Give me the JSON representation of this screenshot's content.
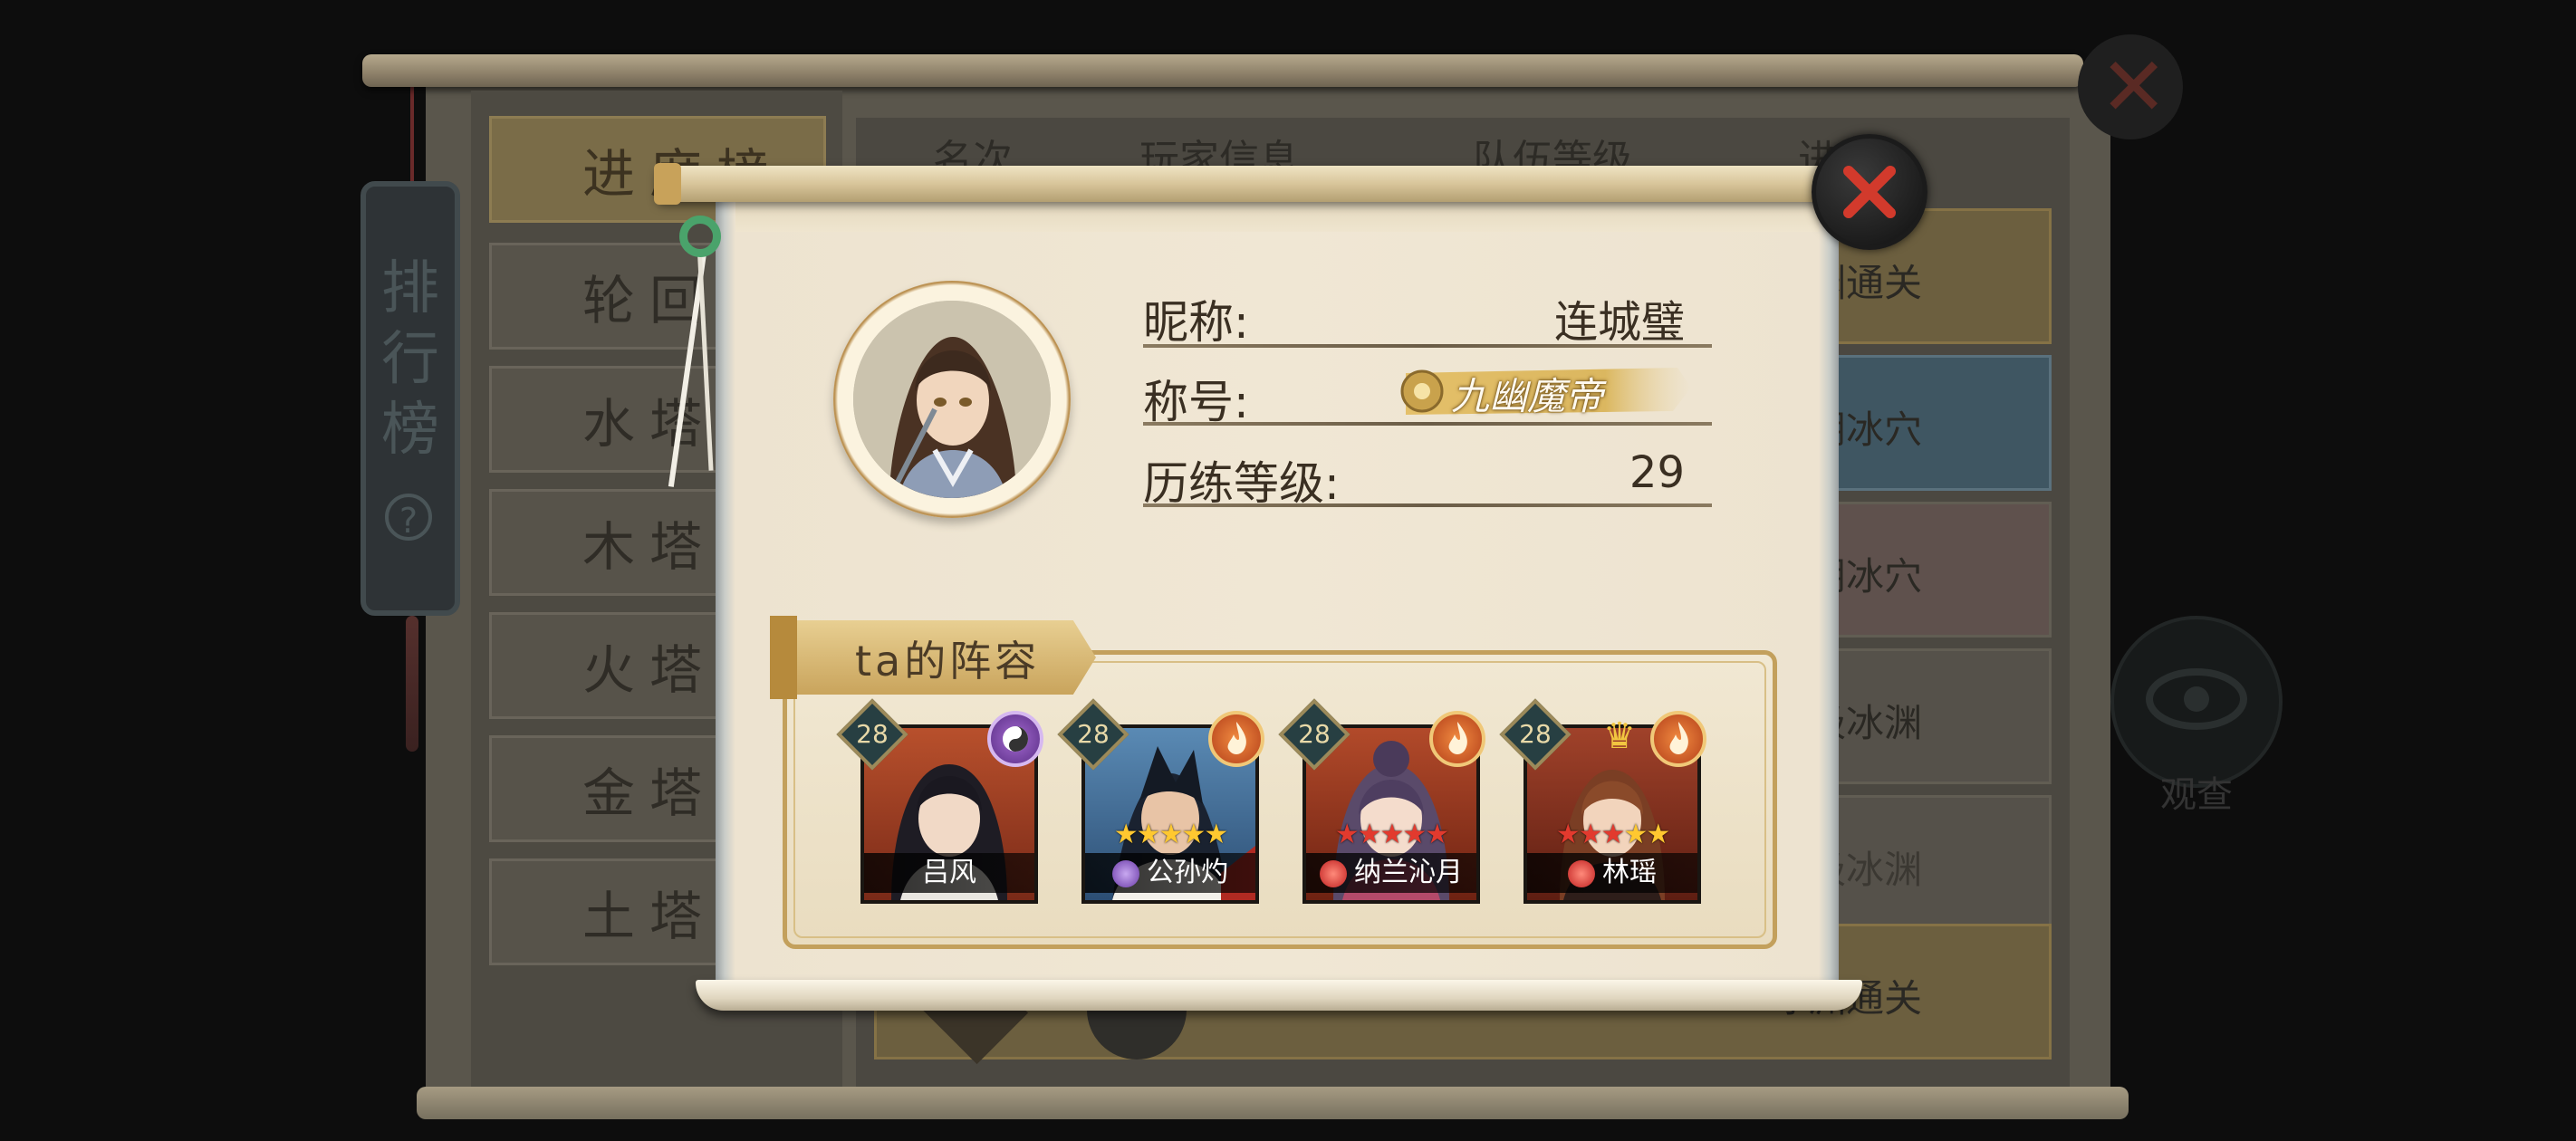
{
  "background_board": {
    "banner_title": "排行榜",
    "help_glyph": "?",
    "tabs": [
      "进度榜",
      "轮回",
      "水塔榜",
      "木塔榜",
      "火塔榜",
      "金塔榜",
      "土塔榜"
    ],
    "table_headers": [
      "名次",
      "玩家信息",
      "队伍等级",
      "进度"
    ],
    "rows": [
      "冰渊通关",
      "阴冰穴",
      "阴冰穴",
      "极冰渊",
      "极冰渊",
      "冰渊通关"
    ],
    "view_label": "观查",
    "close_glyph": "✕"
  },
  "profile": {
    "nickname_label": "昵称:",
    "nickname": "连城璧",
    "title_label": "称号:",
    "title_badge_text": "九幽魔帝",
    "level_label": "历练等级:",
    "level": "29"
  },
  "lineup": {
    "title": "ta的阵容",
    "heroes": [
      {
        "name": "吕风",
        "level": "28",
        "element": "yin-yang-icon",
        "stars": 0,
        "star_color": "none",
        "name_icon": "none"
      },
      {
        "name": "公孙灼",
        "level": "28",
        "element": "fire-icon",
        "stars": 5,
        "star_color": "gold",
        "name_icon": "purple-swirl-icon"
      },
      {
        "name": "纳兰沁月",
        "level": "28",
        "element": "fire-icon",
        "stars": 5,
        "star_color": "red",
        "name_icon": "red-alert-icon"
      },
      {
        "name": "林瑶",
        "level": "28",
        "element": "fire-icon",
        "stars": 5,
        "star_color": "mixed",
        "name_icon": "red-alert-icon"
      }
    ]
  },
  "colors": {
    "modal_paper": "#f0e7d4",
    "close_x": "#d23a2c",
    "gold_trim": "#c3a05c"
  }
}
